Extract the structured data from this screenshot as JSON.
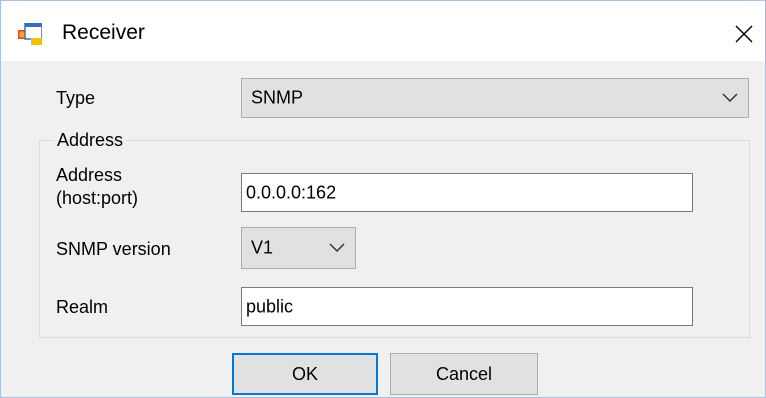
{
  "window": {
    "title": "Receiver",
    "app_icon": "window-app-icon",
    "close_icon": "close-icon"
  },
  "type": {
    "label": "Type",
    "value": "SNMP"
  },
  "address_group": {
    "legend": "Address",
    "address_label_line1": "Address",
    "address_label_line2": "(host:port)",
    "address_value": "0.0.0.0:162",
    "snmp_version_label": "SNMP version",
    "snmp_version_value": "V1",
    "realm_label": "Realm",
    "realm_value": "public"
  },
  "buttons": {
    "ok": "OK",
    "cancel": "Cancel"
  },
  "colors": {
    "accent": "#0078d7",
    "dialog_bg": "#f0f0f0",
    "combo_bg": "#e1e1e1"
  }
}
